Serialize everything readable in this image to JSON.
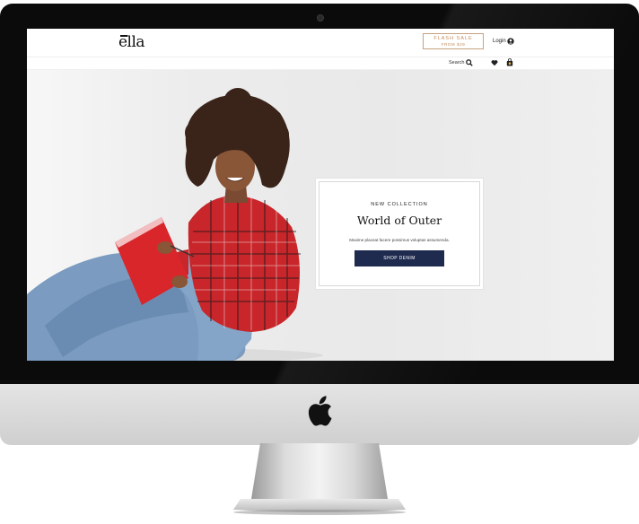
{
  "site": {
    "logo": "ella"
  },
  "header": {
    "flash_sale": {
      "title": "FLASH SALE",
      "subtitle": "FROM $29"
    },
    "login_label": "Login",
    "search_label": "Search"
  },
  "hero": {
    "eyebrow": "NEW COLLECTION",
    "title": "World of Outer",
    "description": "Maxime placeat facere possimus voluptas assumenda.",
    "button_label": "SHOP DENIM"
  },
  "colors": {
    "accent": "#c58a57",
    "button": "#1f2a4f",
    "shirt": "#c8262a",
    "denim": "#7b9cc0"
  }
}
